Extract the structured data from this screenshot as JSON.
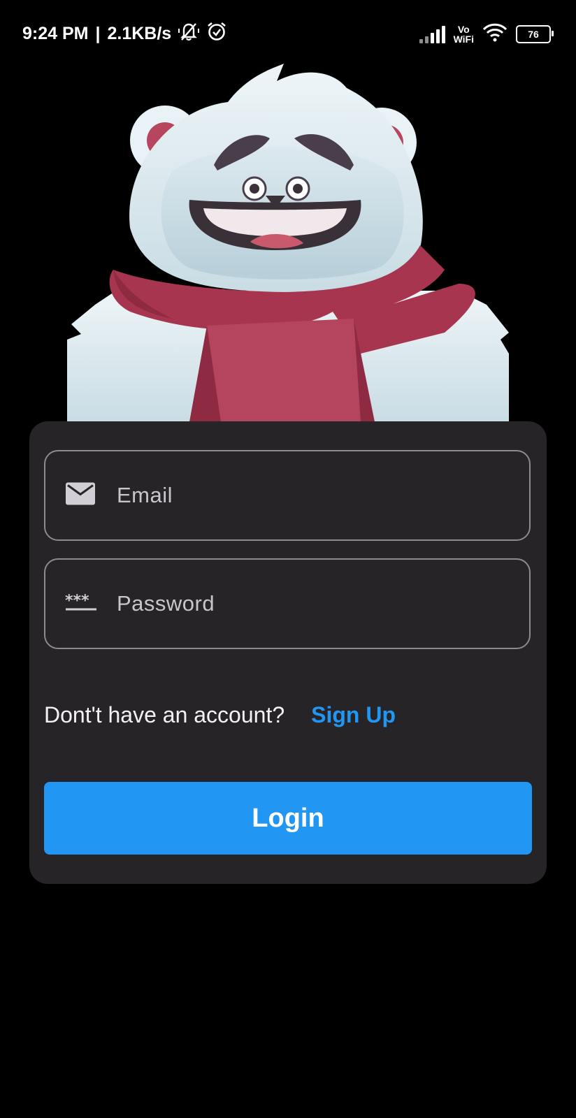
{
  "status_bar": {
    "time": "9:24 PM",
    "network_speed": "2.1KB/s",
    "vowifi_top": "Vo",
    "vowifi_bottom": "WiFi",
    "battery": "76"
  },
  "icons": {
    "muted": "bell-slash-icon",
    "alarm": "alarm-clock-icon",
    "signal": "signal-bars-icon",
    "wifi": "wifi-icon",
    "email": "envelope-icon",
    "password": "password-dots-icon"
  },
  "form": {
    "email_placeholder": "Email",
    "password_placeholder": "Password",
    "signup_prompt": "Dont't have an account?",
    "signup_link": "Sign Up",
    "login_label": "Login"
  },
  "colors": {
    "background": "#000000",
    "card": "#262427",
    "accent": "#2296f3",
    "field_border": "#8d8a91"
  }
}
